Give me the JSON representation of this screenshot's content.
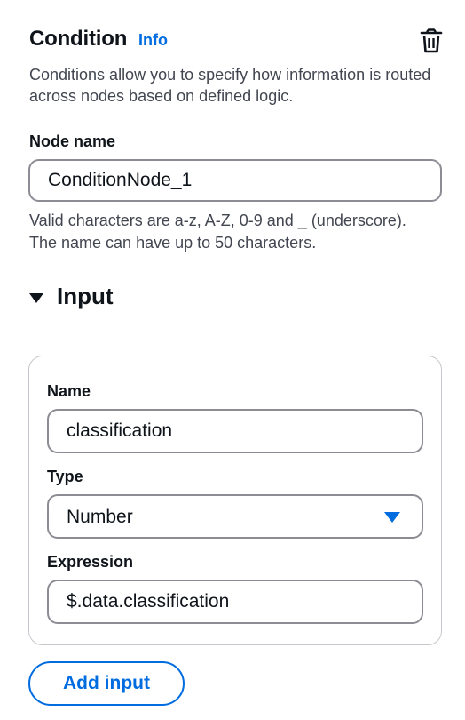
{
  "header": {
    "title": "Condition",
    "info_label": "Info"
  },
  "description": "Conditions allow you to specify how information is routed across nodes based on defined logic.",
  "node_name": {
    "label": "Node name",
    "value": "ConditionNode_1",
    "hint_line1": "Valid characters are a-z, A-Z, 0-9 and _ (underscore).",
    "hint_line2": "The name can have up to 50 characters."
  },
  "input_section": {
    "title": "Input",
    "expanded": true,
    "name_label": "Name",
    "name_value": "classification",
    "type_label": "Type",
    "type_value": "Number",
    "expression_label": "Expression",
    "expression_value": "$.data.classification",
    "add_button_label": "Add input"
  },
  "colors": {
    "accent": "#006ce0",
    "text": "#0f141a",
    "muted": "#424650",
    "border": "#8c8c94"
  }
}
